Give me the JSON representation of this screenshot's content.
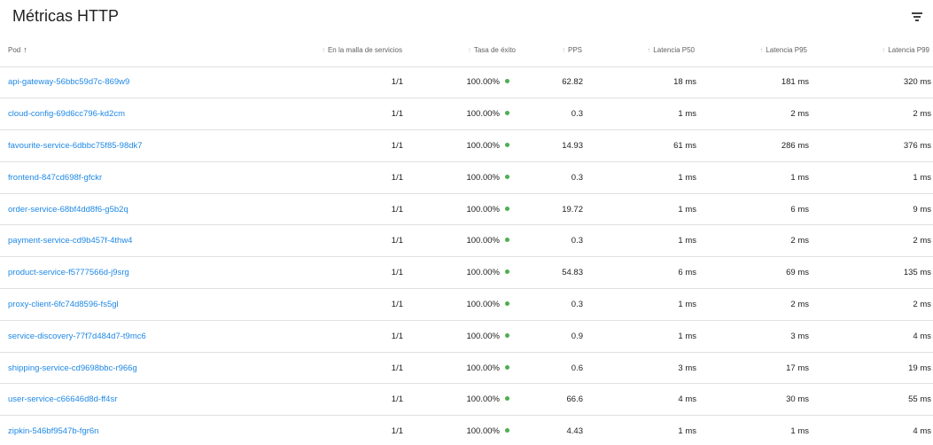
{
  "header": {
    "title": "Métricas HTTP",
    "filter_icon": "filter-list-icon"
  },
  "table": {
    "columns": {
      "pod": "Pod",
      "mesh": "En la malla de servicios",
      "success": "Tasa de éxito",
      "pps": "PPS",
      "p50": "Latencia P50",
      "p95": "Latencia P95",
      "p99": "Latencia P99"
    },
    "sort_arrow": "↑",
    "status_color": "#4caf50",
    "rows": [
      {
        "pod": "api-gateway-56bbc59d7c-869w9",
        "mesh": "1/1",
        "success": "100.00%",
        "pps": "62.82",
        "p50": "18 ms",
        "p95": "181 ms",
        "p99": "320 ms"
      },
      {
        "pod": "cloud-config-69d6cc796-kd2cm",
        "mesh": "1/1",
        "success": "100.00%",
        "pps": "0.3",
        "p50": "1 ms",
        "p95": "2 ms",
        "p99": "2 ms"
      },
      {
        "pod": "favourite-service-6dbbc75f85-98dk7",
        "mesh": "1/1",
        "success": "100.00%",
        "pps": "14.93",
        "p50": "61 ms",
        "p95": "286 ms",
        "p99": "376 ms"
      },
      {
        "pod": "frontend-847cd698f-gfckr",
        "mesh": "1/1",
        "success": "100.00%",
        "pps": "0.3",
        "p50": "1 ms",
        "p95": "1 ms",
        "p99": "1 ms"
      },
      {
        "pod": "order-service-68bf4dd8f6-g5b2q",
        "mesh": "1/1",
        "success": "100.00%",
        "pps": "19.72",
        "p50": "1 ms",
        "p95": "6 ms",
        "p99": "9 ms"
      },
      {
        "pod": "payment-service-cd9b457f-4thw4",
        "mesh": "1/1",
        "success": "100.00%",
        "pps": "0.3",
        "p50": "1 ms",
        "p95": "2 ms",
        "p99": "2 ms"
      },
      {
        "pod": "product-service-f5777566d-j9srg",
        "mesh": "1/1",
        "success": "100.00%",
        "pps": "54.83",
        "p50": "6 ms",
        "p95": "69 ms",
        "p99": "135 ms"
      },
      {
        "pod": "proxy-client-6fc74d8596-fs5gl",
        "mesh": "1/1",
        "success": "100.00%",
        "pps": "0.3",
        "p50": "1 ms",
        "p95": "2 ms",
        "p99": "2 ms"
      },
      {
        "pod": "service-discovery-77f7d484d7-t9mc6",
        "mesh": "1/1",
        "success": "100.00%",
        "pps": "0.9",
        "p50": "1 ms",
        "p95": "3 ms",
        "p99": "4 ms"
      },
      {
        "pod": "shipping-service-cd9698bbc-r966g",
        "mesh": "1/1",
        "success": "100.00%",
        "pps": "0.6",
        "p50": "3 ms",
        "p95": "17 ms",
        "p99": "19 ms"
      },
      {
        "pod": "user-service-c66646d8d-ff4sr",
        "mesh": "1/1",
        "success": "100.00%",
        "pps": "66.6",
        "p50": "4 ms",
        "p95": "30 ms",
        "p99": "55 ms"
      },
      {
        "pod": "zipkin-546bf9547b-fgr6n",
        "mesh": "1/1",
        "success": "100.00%",
        "pps": "4.43",
        "p50": "1 ms",
        "p95": "1 ms",
        "p99": "4 ms"
      }
    ]
  }
}
